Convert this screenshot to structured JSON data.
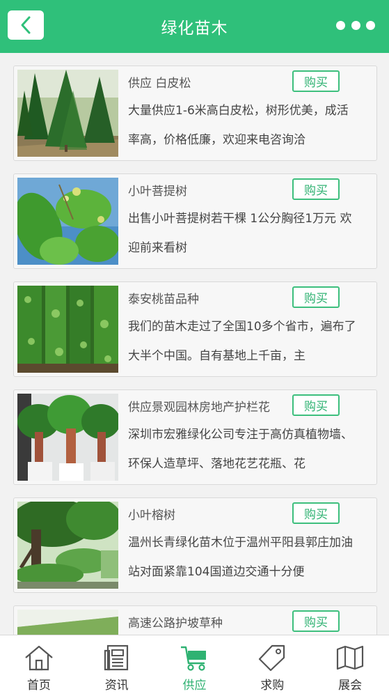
{
  "header": {
    "title": "绿化苗木"
  },
  "products": [
    {
      "title": "供应 白皮松",
      "buy_label": "购买",
      "desc": "大量供应1-6米高白皮松，树形优美，成活率高，价格低廉，欢迎来电咨询洽",
      "image": "pine-trees-photo"
    },
    {
      "title": "小叶菩提树",
      "buy_label": "购买",
      "desc": "出售小叶菩提树若干棵 1公分胸径1万元 欢迎前来看树",
      "image": "linden-leaves-photo"
    },
    {
      "title": "泰安桃苗品种",
      "buy_label": "购买",
      "desc": "我们的苗木走过了全国10多个省市，遍布了大半个中国。自有基地上千亩，主",
      "image": "peach-seedlings-photo"
    },
    {
      "title": "供应景观园林房地产护栏花",
      "buy_label": "购买",
      "desc": "深圳市宏雅绿化公司专注于高仿真植物墙、环保人造草坪、落地花艺花瓶、花",
      "image": "potted-plants-photo"
    },
    {
      "title": "小叶榕树",
      "buy_label": "购买",
      "desc": "温州长青绿化苗木位于温州平阳县郭庄加油站对面紧靠104国道边交通十分便",
      "image": "banyan-tree-photo"
    },
    {
      "title": "高速公路护坡草种",
      "buy_label": "购买",
      "desc": "",
      "image": "grass-slope-photo"
    }
  ],
  "tabbar": {
    "items": [
      {
        "label": "首页",
        "icon": "home-icon"
      },
      {
        "label": "资讯",
        "icon": "news-icon"
      },
      {
        "label": "供应",
        "icon": "cart-icon"
      },
      {
        "label": "求购",
        "icon": "tag-icon"
      },
      {
        "label": "展会",
        "icon": "map-icon"
      }
    ],
    "active": "供应"
  },
  "colors": {
    "brand": "#2fc07a",
    "button_border": "#3dbf7d"
  }
}
